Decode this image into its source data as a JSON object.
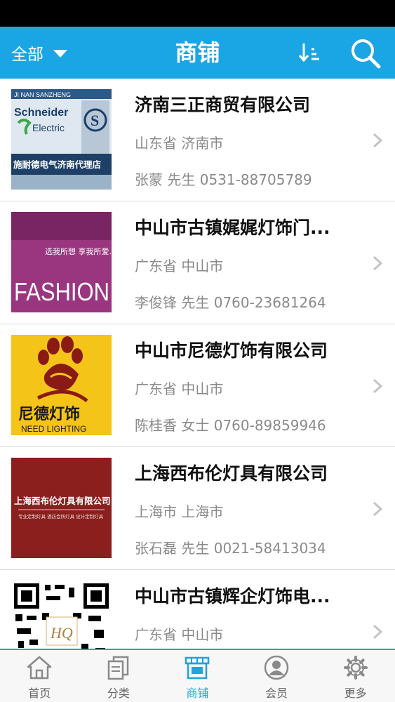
{
  "nav": {
    "filter_label": "全部",
    "title": "商铺",
    "accent_color": "#1aa5e4"
  },
  "stores": [
    {
      "name": "济南三正商贸有限公司",
      "region": "山东省 济南市",
      "contact": "张蒙 先生 0531-88705789",
      "thumb": {
        "header": "JI NAN SANZHENG",
        "brand_top": "Schneider",
        "brand_bottom": "Electric",
        "caption": "施耐德电气济南代理店"
      }
    },
    {
      "name": "中山市古镇娓娓灯饰门...",
      "region": "广东省 中山市",
      "contact": "李俊锋 先生 0760-23681264",
      "thumb": {
        "slogan": "选我所想 享我所爱...",
        "word": "FASHION"
      }
    },
    {
      "name": "中山市尼德灯饰有限公司",
      "region": "广东省 中山市",
      "contact": "陈桂香 女士 0760-89859946",
      "thumb": {
        "brand_cn": "尼德灯饰",
        "brand_en": "NEED LIGHTING"
      }
    },
    {
      "name": "上海西布伦灯具有限公司",
      "region": "上海市 上海市",
      "contact": "张石磊 先生 0021-58413034",
      "thumb": {
        "company": "上海西布伦灯具有限公司",
        "sub": "专业定制灯具 酒店会所灯具 设计定制灯具"
      }
    },
    {
      "name": "中山市古镇辉企灯饰电...",
      "region": "广东省 中山市",
      "contact": "",
      "thumb": {
        "logo": "HQ"
      }
    }
  ],
  "tabs": [
    {
      "label": "首页",
      "icon": "home-icon"
    },
    {
      "label": "分类",
      "icon": "category-icon"
    },
    {
      "label": "商铺",
      "icon": "store-icon",
      "active": true
    },
    {
      "label": "会员",
      "icon": "member-icon"
    },
    {
      "label": "更多",
      "icon": "gear-icon"
    }
  ]
}
